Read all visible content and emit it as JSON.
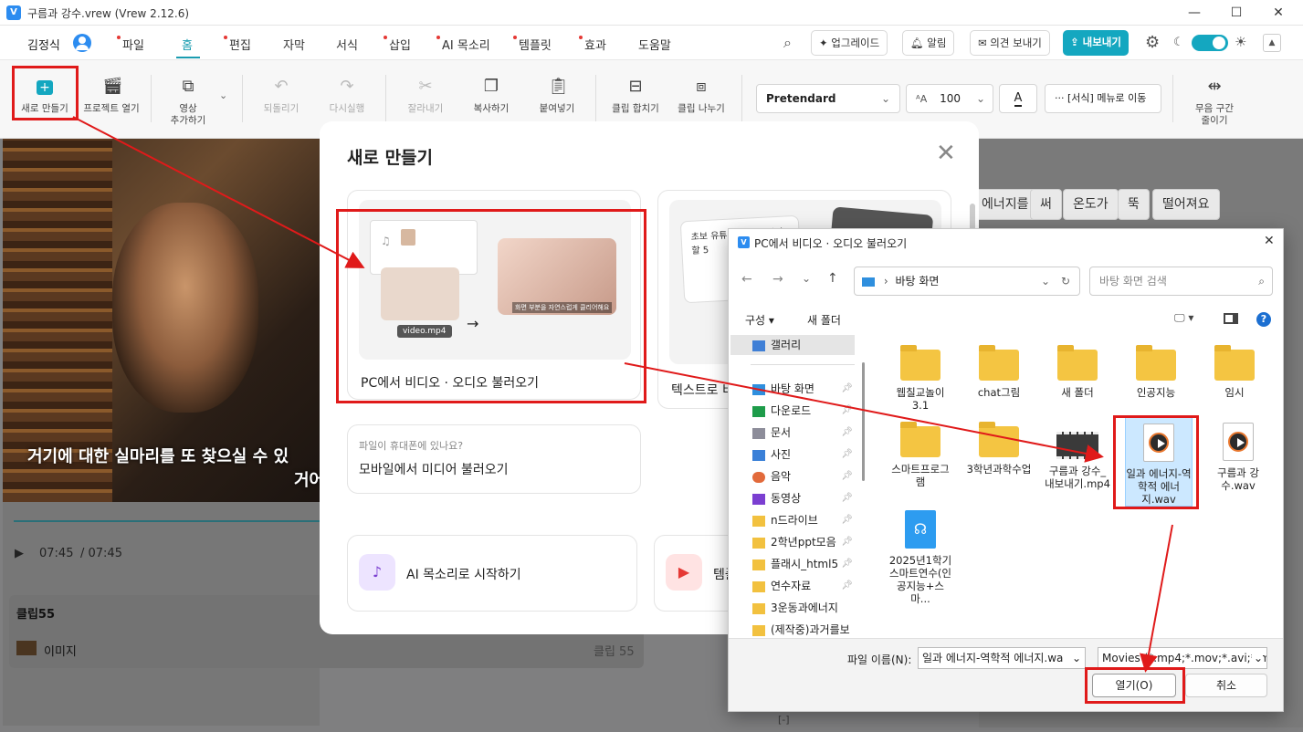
{
  "window": {
    "title": "구름과 강수.vrew (Vrew 2.12.6)",
    "app_icon": "V"
  },
  "menubar": {
    "user": "김정식",
    "items": [
      "파일",
      "홈",
      "편집",
      "자막",
      "서식",
      "삽입",
      "AI 목소리",
      "템플릿",
      "효과",
      "도움말"
    ],
    "active": "홈",
    "upgrade": "업그레이드",
    "alerts": "알림",
    "feedback": "의견 보내기",
    "export": "내보내기"
  },
  "toolbar": {
    "new": "새로 만들기",
    "open": "프로젝트 열기",
    "add_video_1": "영상",
    "add_video_2": "추가하기",
    "undo": "되돌리기",
    "redo": "다시실행",
    "cut": "잘라내기",
    "copy": "복사하기",
    "paste": "붙여넣기",
    "merge": "클립 합치기",
    "split": "클립 나누기",
    "font": "Pretendard",
    "font_size": "100",
    "format_menu": "[서식] 메뉴로 이동",
    "silence_1": "무음 구간",
    "silence_2": "줄이기"
  },
  "editor": {
    "subtitle_1": "거기에 대한 실마리를 또 찾으실 수 있",
    "subtitle_2": "거어",
    "time_current": "07:45",
    "time_total": "/ 07:45",
    "clip_title": "클립55",
    "clip_label": "이미지",
    "clip_ref": "클립 55",
    "chips": [
      "에너지를",
      "써",
      "온도가",
      "뚝",
      "떨어져요"
    ]
  },
  "modal": {
    "title": "새로 만들기",
    "card1_label": "PC에서 비디오 · 오디오 불러오기",
    "card1_file": "video.mp4",
    "card1_caption": "화면 부분을 자연스럽게 클리어해요",
    "card2_label": "텍스트로 비",
    "card2_snippet": "초보 유튜버를 위한 아야 할 5",
    "mobile_hint": "파일이 휴대폰에 있나요?",
    "mobile_label": "모바일에서 미디어 불러오기",
    "ai_voice": "AI 목소리로 시작하기",
    "template": "템플"
  },
  "dialog": {
    "title": "PC에서 비디오 · 오디오 불러오기",
    "path": "바탕 화면",
    "search_placeholder": "바탕 화면 검색",
    "organize": "구성",
    "new_folder": "새 폴더",
    "sidebar": [
      {
        "label": "갤러리",
        "icon": "gallery-icon",
        "color": "#3f7fd6"
      },
      {
        "label": "바탕 화면",
        "icon": "desktop-icon",
        "color": "#2f8fde"
      },
      {
        "label": "다운로드",
        "icon": "download-icon",
        "color": "#1e9c4a"
      },
      {
        "label": "문서",
        "icon": "document-icon",
        "color": "#8d8d9a"
      },
      {
        "label": "사진",
        "icon": "pictures-icon",
        "color": "#3a80d8"
      },
      {
        "label": "음악",
        "icon": "music-icon",
        "color": "#e26a3b"
      },
      {
        "label": "동영상",
        "icon": "videos-icon",
        "color": "#7b3fd1"
      },
      {
        "label": "n드라이브",
        "icon": "folder-icon",
        "color": "#f2c13f"
      },
      {
        "label": "2학년ppt모음",
        "icon": "folder-icon",
        "color": "#f2c13f"
      },
      {
        "label": "플래시_html5",
        "icon": "folder-icon",
        "color": "#f2c13f"
      },
      {
        "label": "연수자료",
        "icon": "folder-icon",
        "color": "#f2c13f"
      },
      {
        "label": "3운동과에너지",
        "icon": "folder-icon",
        "color": "#f2c13f"
      },
      {
        "label": "(제작중)과거를보",
        "icon": "folder-icon",
        "color": "#f2c13f"
      }
    ],
    "files": [
      {
        "name": "웹칠교놀이 3.1",
        "type": "folder"
      },
      {
        "name": "chat그림",
        "type": "folder"
      },
      {
        "name": "새 폴더",
        "type": "folder"
      },
      {
        "name": "인공지능",
        "type": "folder"
      },
      {
        "name": "임시",
        "type": "folder"
      },
      {
        "name": "스마트프로그램",
        "type": "folder"
      },
      {
        "name": "3학년과학수업",
        "type": "folder"
      },
      {
        "name": "구름과 강수_내보내기.mp4",
        "type": "video"
      },
      {
        "name": "일과 에너지-역학적 에너지.wav",
        "type": "wav",
        "selected": true
      },
      {
        "name": "구름과 강수.wav",
        "type": "wav"
      },
      {
        "name": "2025년1학기스마트연수(인공지능+스마...",
        "type": "doc"
      }
    ],
    "filename_label": "파일 이름(N):",
    "filename_value": "일과 에너지-역학적 에너지.wa",
    "filter_value": "Movies (*.mp4;*.mov;*.avi;*.mp",
    "open_btn": "열기(O)",
    "cancel_btn": "취소"
  },
  "colors": {
    "accent": "#14a7c0",
    "annotation": "#e01a1a"
  }
}
